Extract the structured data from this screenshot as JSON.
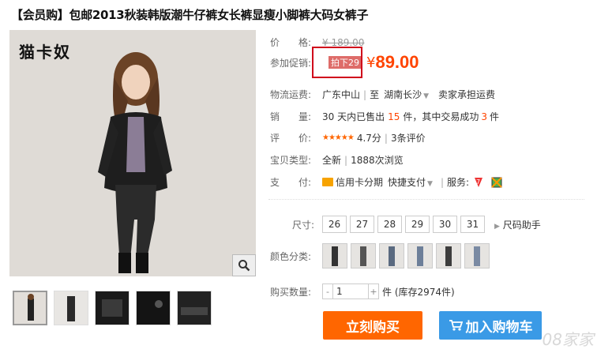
{
  "title": "【会员购】包邮2013秋装韩版潮牛仔裤女长裤显瘦小脚裤大码女裤子",
  "brand": "猫卡奴",
  "price": {
    "label": "价　　格:",
    "original": "¥ 189.00"
  },
  "promo": {
    "label": "参加促销:",
    "tag": "拍下29",
    "yen": "¥",
    "price": "89.00"
  },
  "shipping": {
    "label": "物流运费:",
    "from": "广东中山",
    "to_prefix": "至",
    "to": "湖南长沙",
    "fee": "卖家承担运费"
  },
  "sales": {
    "label": "销　　量:",
    "prefix": "30 天内已售出",
    "sold": "15",
    "middle": "件，其中交易成功",
    "success": "3",
    "suffix": "件"
  },
  "rating": {
    "label": "评　　价:",
    "stars": "★★★★★",
    "score": "4.7分",
    "reviews": "3条评价"
  },
  "type": {
    "label": "宝贝类型:",
    "condition": "全新",
    "views": "1888次浏览"
  },
  "payment": {
    "label": "支　　付:",
    "credit": "信用卡分期",
    "quick": "快捷支付",
    "service_label": "服务:"
  },
  "sizes": {
    "label": "尺寸:",
    "options": [
      "26",
      "27",
      "28",
      "29",
      "30",
      "31"
    ],
    "helper": "尺码助手"
  },
  "colors": {
    "label": "颜色分类:",
    "count": 6
  },
  "quantity": {
    "label": "购买数量:",
    "value": "1",
    "stock": "件 (库存2974件)"
  },
  "buttons": {
    "buy": "立刻购买",
    "cart": "加入购物车"
  },
  "watermark": "08家家"
}
